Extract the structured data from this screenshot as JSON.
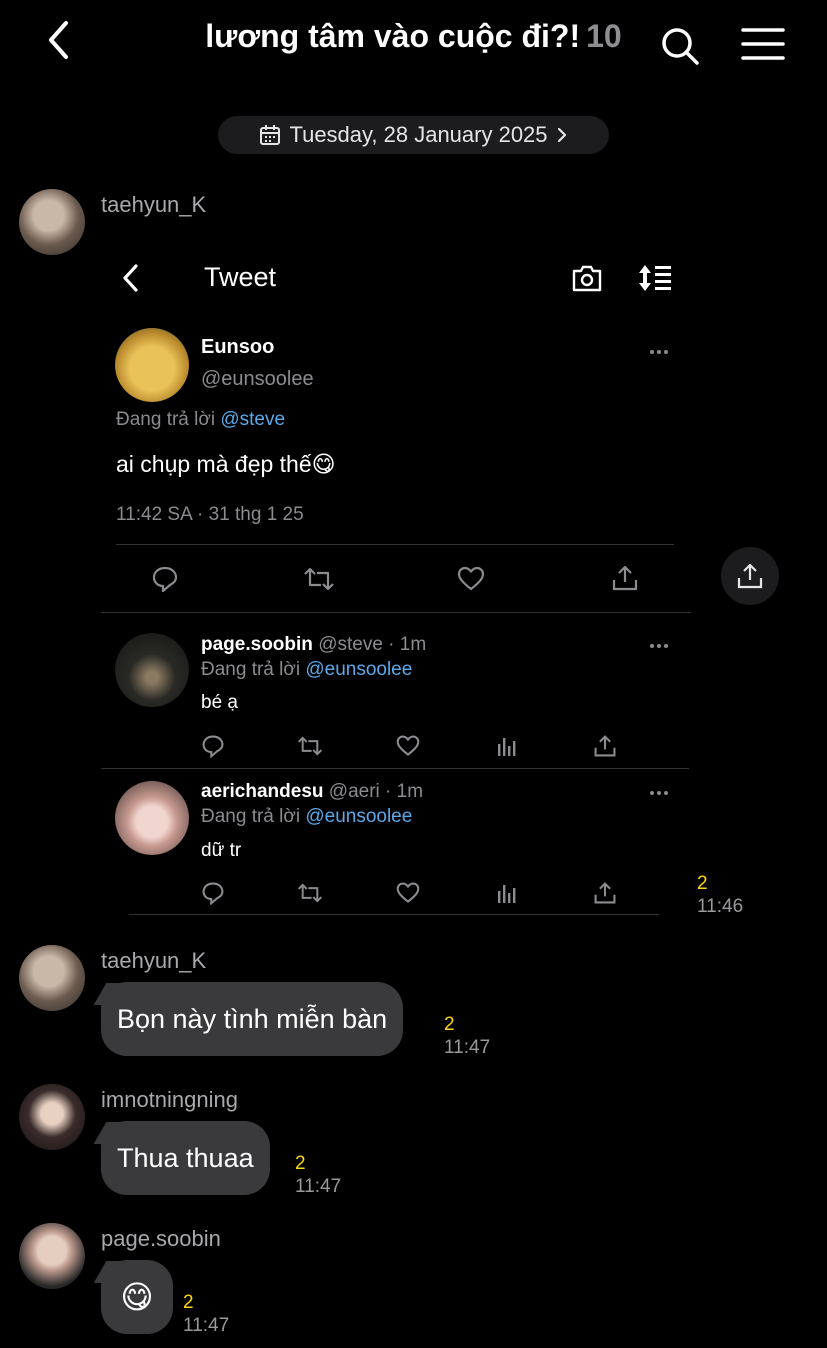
{
  "header": {
    "title": "lương tâm vào cuộc đi?!",
    "unread_count": "10"
  },
  "date_separator": "Tuesday, 28 January 2025",
  "messages": [
    {
      "sender": "taehyun_K",
      "type": "screenshot",
      "reads": "2",
      "time": "11:46",
      "tweet": {
        "header_title": "Tweet",
        "author_name": "Eunsoo",
        "author_handle": "@eunsoolee",
        "replying_label": "Đang trả lời",
        "replying_to": "@steve",
        "text": "ai chụp mà đẹp thế😋",
        "timestamp": "11:42 SA · 31 thg 1 25",
        "replies": [
          {
            "name": "page.soobin",
            "handle_time": "@steve · 1m",
            "replying_label": "Đang trả lời",
            "replying_to": "@eunsoolee",
            "text": "bé ạ"
          },
          {
            "name": "aerichandesu",
            "handle_time": "@aeri · 1m",
            "replying_label": "Đang trả lời",
            "replying_to": "@eunsoolee",
            "text": "dữ tr"
          }
        ]
      }
    },
    {
      "sender": "taehyun_K",
      "text": "Bọn này tình miễn bàn",
      "reads": "2",
      "time": "11:47"
    },
    {
      "sender": "imnotningning",
      "text": "Thua thuaa",
      "reads": "2",
      "time": "11:47"
    },
    {
      "sender": "page.soobin",
      "text": "😋",
      "reads": "2",
      "time": "11:47"
    }
  ],
  "colors": {
    "background": "#000000",
    "bubble": "#3a3a3c",
    "read_count": "#ffd60a",
    "link": "#5aa9ea"
  }
}
